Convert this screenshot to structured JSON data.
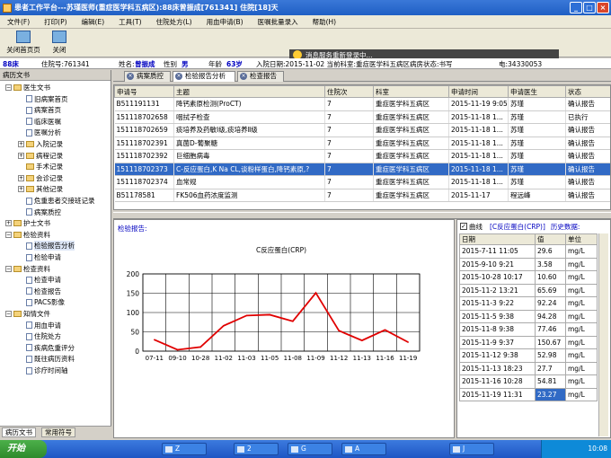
{
  "window": {
    "title": "患者工作平台---苏瑾医师(重症医学科五病区):88床曾振成[761341] 住院[18]天"
  },
  "menu": [
    "文件(F)",
    "打印(P)",
    "编辑(E)",
    "工具(T)",
    "住院处方(L)",
    "用血申请(B)",
    "医嘱批量录入",
    "帮助(H)"
  ],
  "toolbar": {
    "home": "关闭首页页",
    "close": "关闭"
  },
  "notice": "消息服务重新登录中...",
  "patient": {
    "bed": "88床",
    "id_label": "住院号:761341",
    "name_label": "姓名:",
    "name": "曾振成",
    "sex_label": "性别",
    "sex": "男",
    "age_label": "年龄",
    "age": "63岁",
    "admit": "入院日期:2015-11-02 当前科室:重症医学科五病区病房状态:书写",
    "phone": "电:34330053"
  },
  "left": {
    "header": "病历文书",
    "tree": [
      {
        "label": "医生文书",
        "t": "folder",
        "exp": "−"
      },
      {
        "label": "旧病案首页",
        "t": "doc"
      },
      {
        "label": "病案首页",
        "t": "doc"
      },
      {
        "label": "临床医嘱",
        "t": "doc"
      },
      {
        "label": "医嘱分析",
        "t": "doc"
      },
      {
        "label": "入院记录",
        "t": "folder",
        "exp": "+"
      },
      {
        "label": "病程记录",
        "t": "folder",
        "exp": "+"
      },
      {
        "label": "手术记录",
        "t": "folder"
      },
      {
        "label": "会诊记录",
        "t": "folder",
        "exp": "+"
      },
      {
        "label": "其他记录",
        "t": "folder",
        "exp": "+"
      },
      {
        "label": "危重患者交接班记录",
        "t": "doc"
      },
      {
        "label": "病案质控",
        "t": "doc"
      },
      {
        "label": "护士文书",
        "t": "folder",
        "exp": "+"
      },
      {
        "label": "检验资料",
        "t": "folder",
        "exp": "−"
      },
      {
        "label": "检验报告分析",
        "t": "doc"
      },
      {
        "label": "检验申请",
        "t": "doc"
      },
      {
        "label": "检查资料",
        "t": "folder",
        "exp": "−"
      },
      {
        "label": "检查申请",
        "t": "doc"
      },
      {
        "label": "检查报告",
        "t": "doc"
      },
      {
        "label": "PACS影像",
        "t": "doc"
      },
      {
        "label": "知情文件",
        "t": "folder",
        "exp": "−"
      },
      {
        "label": "用血申请",
        "t": "doc"
      },
      {
        "label": "住院处方",
        "t": "doc"
      },
      {
        "label": "疾病危重评分",
        "t": "doc"
      },
      {
        "label": "既往病历资料",
        "t": "doc"
      },
      {
        "label": "诊疗时间轴",
        "t": "doc"
      }
    ],
    "tabs": [
      "病历文书",
      "常用符号"
    ]
  },
  "tabs": [
    "病案质控",
    "检验报告分析",
    "检查报告"
  ],
  "grid": {
    "headers": [
      "申请号",
      "主题",
      "住院次",
      "科室",
      "申请时间",
      "申请医生",
      "状态"
    ],
    "rows": [
      [
        "B511191131",
        "降钙素原检测(ProCT)",
        "7",
        "重症医学科五病区",
        "2015-11-19 9:05",
        "苏瑾",
        "确认报告"
      ],
      [
        "151118702658",
        "咽拭子检查",
        "7",
        "重症医学科五病区",
        "2015-11-18 1...",
        "苏瑾",
        "已执行"
      ],
      [
        "151118702659",
        "痰培养及药敏Ⅰ级,痰培养Ⅱ级",
        "7",
        "重症医学科五病区",
        "2015-11-18 1...",
        "苏瑾",
        "确认报告"
      ],
      [
        "151118702391",
        "真菌D-葡聚糖",
        "7",
        "重症医学科五病区",
        "2015-11-18 1...",
        "苏瑾",
        "确认报告"
      ],
      [
        "151118702392",
        "巨细胞病毒",
        "7",
        "重症医学科五病区",
        "2015-11-18 1...",
        "苏瑾",
        "确认报告"
      ],
      [
        "151118702373",
        "C-反应蛋白,K Na CL,谈粉样蛋白,降钙素原,?",
        "7",
        "重症医学科五病区",
        "2015-11-18 1...",
        "苏瑾",
        "确认报告"
      ],
      [
        "151118702374",
        "血常规",
        "7",
        "重症医学科五病区",
        "2015-11-18 1...",
        "苏瑾",
        "确认报告"
      ],
      [
        "B51178581",
        "FK506血药浓度监测",
        "7",
        "重症医学科五病区",
        "2015-11-17",
        "程远峰",
        "确认报告"
      ]
    ],
    "selected": 5
  },
  "chart_label": "检验报告:",
  "right": {
    "checkbox": "曲线",
    "item": "[C反应蛋白(CRP)]",
    "history": "历史数据:",
    "headers": [
      "日期",
      "值",
      "单位"
    ],
    "rows": [
      [
        "2015-7-11 11:05",
        "29.6",
        "mg/L"
      ],
      [
        "2015-9-10 9:21",
        "3.58",
        "mg/L"
      ],
      [
        "2015-10-28 10:17",
        "10.60",
        "mg/L"
      ],
      [
        "2015-11-2 13:21",
        "65.69",
        "mg/L"
      ],
      [
        "2015-11-3 9:22",
        "92.24",
        "mg/L"
      ],
      [
        "2015-11-5 9:38",
        "94.28",
        "mg/L"
      ],
      [
        "2015-11-8 9:38",
        "77.46",
        "mg/L"
      ],
      [
        "2015-11-9 9:37",
        "150.67",
        "mg/L"
      ],
      [
        "2015-11-12 9:38",
        "52.98",
        "mg/L"
      ],
      [
        "2015-11-13 18:23",
        "27.7",
        "mg/L"
      ],
      [
        "2015-11-16 10:28",
        "54.81",
        "mg/L"
      ],
      [
        "2015-11-19 11:31",
        "23.27",
        "mg/L"
      ]
    ]
  },
  "chart_data": {
    "type": "line",
    "title": "C反应蛋白(CRP)",
    "categories": [
      "07-11",
      "09-10",
      "10-28",
      "11-02",
      "11-03",
      "11-05",
      "11-08",
      "11-09",
      "11-12",
      "11-13",
      "11-16",
      "11-19"
    ],
    "values": [
      29.6,
      3.58,
      10.6,
      65.69,
      92.24,
      94.28,
      77.46,
      150.67,
      52.98,
      27.7,
      54.81,
      23.27
    ],
    "ylim": [
      0,
      200
    ],
    "yticks": [
      0,
      50,
      100,
      150,
      200
    ],
    "grid": true,
    "color": "#e00000"
  },
  "taskbar": {
    "start": "开始",
    "items": [
      "Z",
      "2",
      "G",
      "A",
      "J"
    ],
    "clock": "10:08"
  }
}
